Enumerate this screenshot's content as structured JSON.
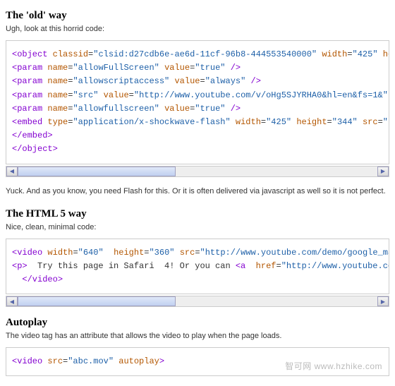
{
  "sections": [
    {
      "heading": "The 'old' way",
      "subtitle": "Ugh, look at this horrid code:",
      "code_lines": [
        [
          [
            "tag",
            "<object"
          ],
          [
            "txt",
            " "
          ],
          [
            "attr",
            "classid"
          ],
          [
            "txt",
            "="
          ],
          [
            "val",
            "\"clsid:d27cdb6e-ae6d-11cf-96b8-444553540000\""
          ],
          [
            "txt",
            " "
          ],
          [
            "attr",
            "width"
          ],
          [
            "txt",
            "="
          ],
          [
            "val",
            "\"425\""
          ],
          [
            "txt",
            " "
          ],
          [
            "attr",
            "heig"
          ]
        ],
        [
          [
            "tag",
            "<param"
          ],
          [
            "txt",
            " "
          ],
          [
            "attr",
            "name"
          ],
          [
            "txt",
            "="
          ],
          [
            "val",
            "\"allowFullScreen\""
          ],
          [
            "txt",
            " "
          ],
          [
            "attr",
            "value"
          ],
          [
            "txt",
            "="
          ],
          [
            "val",
            "\"true\""
          ],
          [
            "txt",
            " "
          ],
          [
            "tag",
            "/>"
          ]
        ],
        [
          [
            "tag",
            "<param"
          ],
          [
            "txt",
            " "
          ],
          [
            "attr",
            "name"
          ],
          [
            "txt",
            "="
          ],
          [
            "val",
            "\"allowscriptaccess\""
          ],
          [
            "txt",
            " "
          ],
          [
            "attr",
            "value"
          ],
          [
            "txt",
            "="
          ],
          [
            "val",
            "\"always\""
          ],
          [
            "txt",
            " "
          ],
          [
            "tag",
            "/>"
          ]
        ],
        [
          [
            "tag",
            "<param"
          ],
          [
            "txt",
            " "
          ],
          [
            "attr",
            "name"
          ],
          [
            "txt",
            "="
          ],
          [
            "val",
            "\"src\""
          ],
          [
            "txt",
            " "
          ],
          [
            "attr",
            "value"
          ],
          [
            "txt",
            "="
          ],
          [
            "val",
            "\"http://www.youtube.com/v/oHg5SJYRHA0&hl=en&fs=1&\""
          ],
          [
            "txt",
            " "
          ],
          [
            "tag",
            "/>"
          ]
        ],
        [
          [
            "tag",
            "<param"
          ],
          [
            "txt",
            " "
          ],
          [
            "attr",
            "name"
          ],
          [
            "txt",
            "="
          ],
          [
            "val",
            "\"allowfullscreen\""
          ],
          [
            "txt",
            " "
          ],
          [
            "attr",
            "value"
          ],
          [
            "txt",
            "="
          ],
          [
            "val",
            "\"true\""
          ],
          [
            "txt",
            " "
          ],
          [
            "tag",
            "/>"
          ]
        ],
        [
          [
            "tag",
            "<embed"
          ],
          [
            "txt",
            " "
          ],
          [
            "attr",
            "type"
          ],
          [
            "txt",
            "="
          ],
          [
            "val",
            "\"application/x-shockwave-flash\""
          ],
          [
            "txt",
            " "
          ],
          [
            "attr",
            "width"
          ],
          [
            "txt",
            "="
          ],
          [
            "val",
            "\"425\""
          ],
          [
            "txt",
            " "
          ],
          [
            "attr",
            "height"
          ],
          [
            "txt",
            "="
          ],
          [
            "val",
            "\"344\""
          ],
          [
            "txt",
            " "
          ],
          [
            "attr",
            "src"
          ],
          [
            "txt",
            "="
          ],
          [
            "val",
            "\"htt"
          ]
        ],
        [
          [
            "tag",
            "</embed>"
          ]
        ],
        [
          [
            "tag",
            "</object>"
          ]
        ]
      ],
      "thumb_width": "44%",
      "after": "Yuck. And as you know, you need Flash for this. Or it is often delivered via javascript as well so it is not perfect."
    },
    {
      "heading": "The HTML 5 way",
      "subtitle": "Nice, clean, minimal code:",
      "code_lines": [
        [
          [
            "tag",
            "<video"
          ],
          [
            "txt",
            " "
          ],
          [
            "attr",
            "width"
          ],
          [
            "txt",
            "="
          ],
          [
            "val",
            "\"640\""
          ],
          [
            "txt",
            "  "
          ],
          [
            "attr",
            "height"
          ],
          [
            "txt",
            "="
          ],
          [
            "val",
            "\"360\""
          ],
          [
            "txt",
            " "
          ],
          [
            "attr",
            "src"
          ],
          [
            "txt",
            "="
          ],
          [
            "val",
            "\"http://www.youtube.com/demo/google_main"
          ]
        ],
        [
          [
            "tag",
            "<p>"
          ],
          [
            "txt",
            "  Try this page in Safari  4! Or you can "
          ],
          [
            "tag",
            "<a"
          ],
          [
            "txt",
            "  "
          ],
          [
            "attr",
            "href"
          ],
          [
            "txt",
            "="
          ],
          [
            "val",
            "\"http://www.youtube.com/d"
          ]
        ],
        [
          [
            "txt",
            "  "
          ],
          [
            "tag",
            "</video>"
          ]
        ]
      ],
      "thumb_width": "44%",
      "after": ""
    },
    {
      "heading": "Autoplay",
      "subtitle": "The video tag has an attribute that allows the video to play when the page loads.",
      "code_lines": [
        [
          [
            "tag",
            "<video"
          ],
          [
            "txt",
            " "
          ],
          [
            "attr",
            "src"
          ],
          [
            "txt",
            "="
          ],
          [
            "val",
            "\"abc.mov\""
          ],
          [
            "txt",
            " "
          ],
          [
            "attr",
            "autoplay"
          ],
          [
            "tag",
            ">"
          ]
        ]
      ],
      "thumb_width": "",
      "after": ""
    }
  ],
  "watermark": "智可网 www.hzhike.com"
}
